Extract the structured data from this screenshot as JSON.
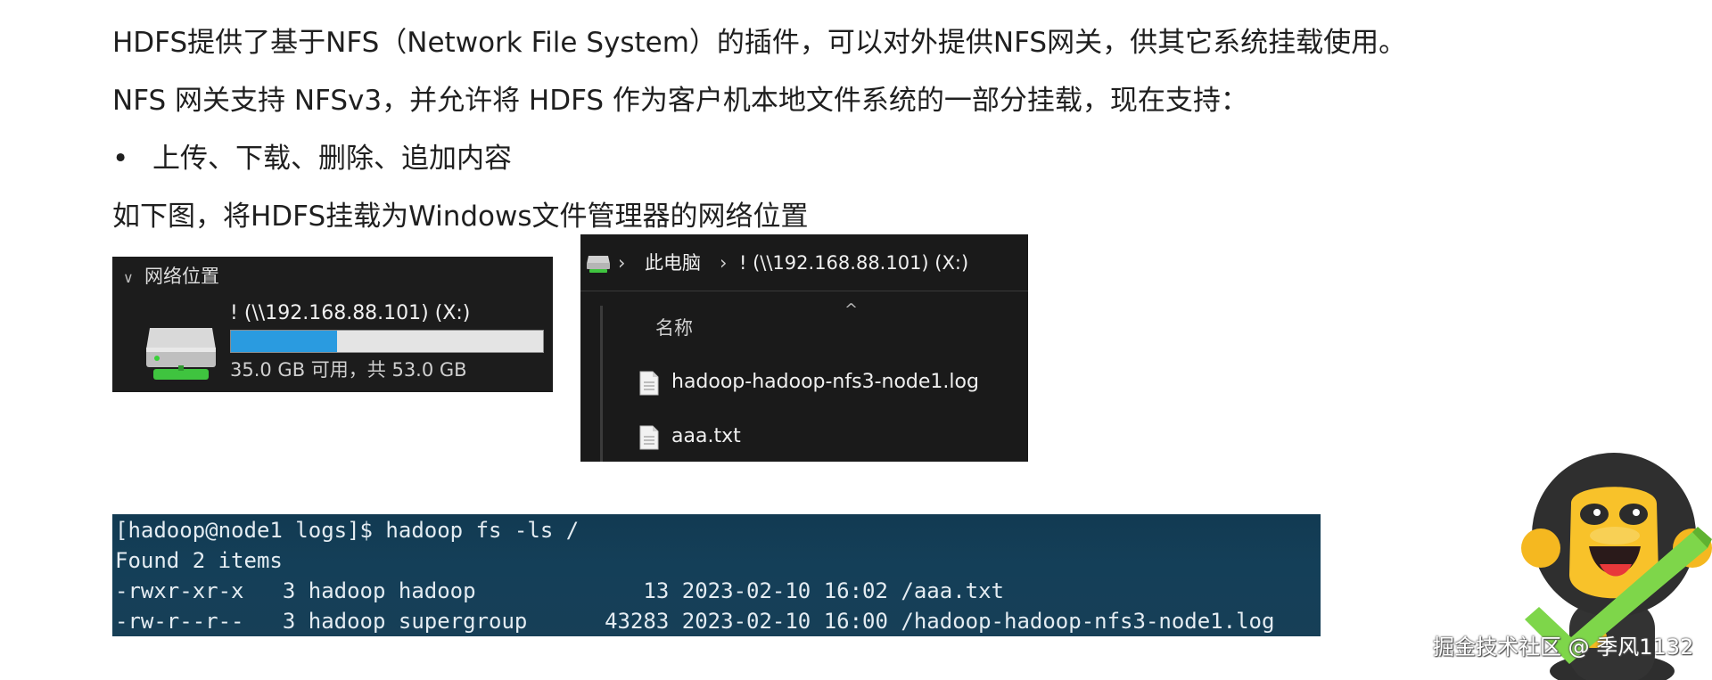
{
  "paragraphs": {
    "intro": "HDFS提供了基于NFS（Network File System）的插件，可以对外提供NFS网关，供其它系统挂载使用。",
    "gateway": "NFS 网关支持 NFSv3，并允许将 HDFS 作为客户机本地文件系统的一部分挂载，现在支持：",
    "bullet_marker": "•",
    "bullet": "上传、下载、删除、追加内容",
    "figure_caption": "如下图，将HDFS挂载为Windows文件管理器的网络位置"
  },
  "network_panel": {
    "section_title": "网络位置",
    "chevron": "∨",
    "drive_name": "! (\\\\192.168.88.101) (X:)",
    "used_fraction": 0.34,
    "space_text": "35.0 GB 可用，共 53.0 GB",
    "bar_color": "#2a9be0",
    "icon": "network-drive-icon"
  },
  "explorer_panel": {
    "breadcrumb": [
      "此电脑",
      "! (\\\\192.168.88.101) (X:)"
    ],
    "separator": "›",
    "column_header": "名称",
    "sort_indicator": "^",
    "files": [
      {
        "name": "hadoop-hadoop-nfs3-node1.log",
        "icon": "file-icon"
      },
      {
        "name": "aaa.txt",
        "icon": "file-icon"
      }
    ]
  },
  "terminal": {
    "lines": [
      "[hadoop@node1 logs]$ hadoop fs -ls /",
      "Found 2 items",
      "-rwxr-xr-x   3 hadoop hadoop             13 2023-02-10 16:02 /aaa.txt",
      "-rw-r--r--   3 hadoop supergroup      43283 2023-02-10 16:00 /hadoop-hadoop-nfs3-node1.log"
    ]
  },
  "watermark": "掘金技术社区 @ 季风1132"
}
